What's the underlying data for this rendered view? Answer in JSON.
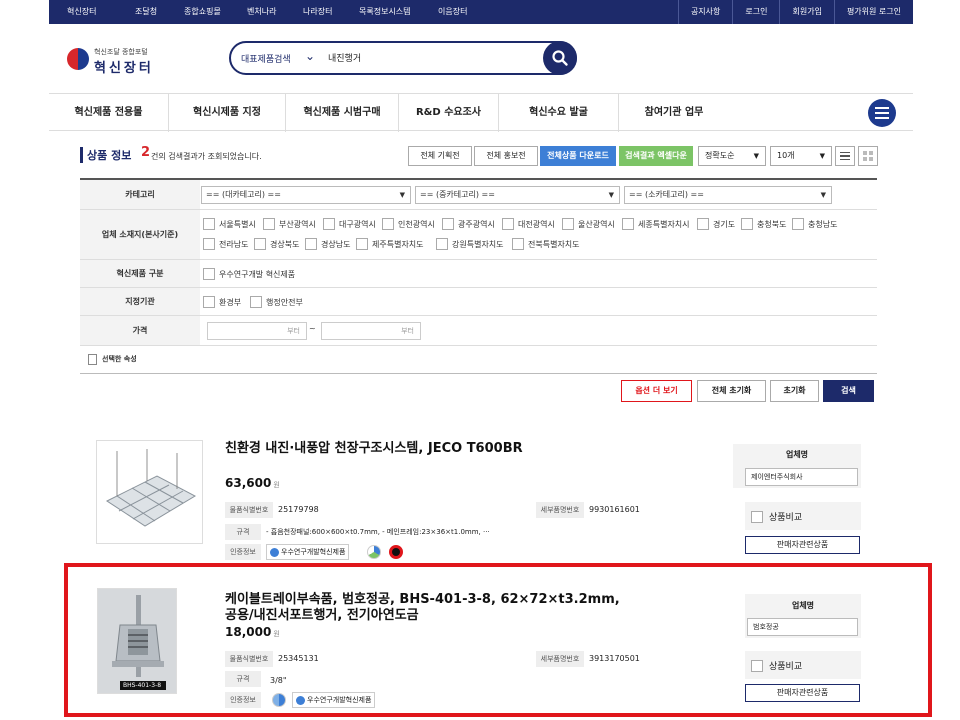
{
  "topnav": {
    "left": [
      "혁신장터",
      "조달청",
      "종합쇼핑몰",
      "벤처나라",
      "나라장터",
      "목록정보시스템",
      "이음장터"
    ],
    "right": [
      "공지사항",
      "로그인",
      "회원가입",
      "평가위원 로그인"
    ]
  },
  "logo": {
    "sub": "혁신조달 종합포털",
    "main": "혁신장터"
  },
  "search": {
    "category": "대표제품검색",
    "value": "내진행거",
    "icon": "search-icon"
  },
  "menu": [
    "혁신제품 전용몰",
    "혁신시제품 지정",
    "혁신제품 시범구매",
    "R&D 수요조사",
    "혁신수요 발굴",
    "참여기관 업무"
  ],
  "results": {
    "title": "상품 정보",
    "count": "2",
    "text": "건의 검색결과가 조회되었습니다.",
    "buttons": [
      "전체 기획전",
      "전체 홍보전",
      "전체상품 다운로드",
      "검색결과 엑셀다운"
    ],
    "sort": "정확도순",
    "per_page": "10개"
  },
  "filter": {
    "category_label": "카테고리",
    "category_drops": [
      "== (대카테고리) ==",
      "== (중카테고리) ==",
      "== (소카테고리) =="
    ],
    "region_label": "업체 소재지(본사기준)",
    "regions": [
      "서울특별시",
      "부산광역시",
      "대구광역시",
      "인천광역시",
      "광주광역시",
      "대전광역시",
      "울산광역시",
      "세종특별자치시",
      "경기도",
      "충청북도",
      "충청남도",
      "전라남도",
      "경상북도",
      "경상남도",
      "제주특별자치도",
      "강원특별자치도",
      "전북특별자치도"
    ],
    "type_label": "혁신제품 구분",
    "types": [
      "우수연구개발 혁신제품"
    ],
    "agency_label": "지정기관",
    "agencies": [
      "환경부",
      "행정안전부"
    ],
    "price_label": "가격",
    "price_from": "부터",
    "price_tilde": "~",
    "price_to": "부터",
    "selected_label": "선택한 속성"
  },
  "actions": [
    "옵션 더 보기",
    "전체 초기화",
    "초기화",
    "검색"
  ],
  "products": [
    {
      "name": "친환경 내진·내풍압 천장구조시스템, JECO T600BR",
      "price": "63,600",
      "won": "원",
      "id_label": "물품식별번호",
      "id": "25179798",
      "tax_label": "세부품명번호",
      "tax": "9930161601",
      "spec_label": "규격",
      "spec": "- 흡음천장패널:600×600×t0.7mm, - 메인프레임:23×36×t1.0mm, ···",
      "cert_label": "인증정보",
      "cert_badge": "우수연구개발혁신제품",
      "vendor_label": "업체명",
      "vendor": "제이엔터주식회사",
      "compare": "상품비교",
      "seller_btn": "판매자관련상품"
    },
    {
      "name_line1": "케이블트레이부속품, 범호정공, BHS-401-3-8, 62×72×t3.2mm,",
      "name_line2": "공용/내진서포트행거, 전기아연도금",
      "price": "18,000",
      "won": "원",
      "id_label": "물품식별번호",
      "id": "25345131",
      "tax_label": "세부품명번호",
      "tax": "3913170501",
      "spec_label": "규격",
      "spec": "3/8\"",
      "cert_label": "인증정보",
      "cert_badge": "우수연구개발혁신제품",
      "img_label": "BHS-401-3-8",
      "vendor_label": "업체명",
      "vendor": "범호정공",
      "compare": "상품비교",
      "seller_btn": "판매자관련상품"
    }
  ],
  "colors": {
    "navy": "#1d2a6a",
    "red": "#e0161b",
    "blue_btn": "#3d7fd6",
    "green_btn": "#7cc466"
  }
}
